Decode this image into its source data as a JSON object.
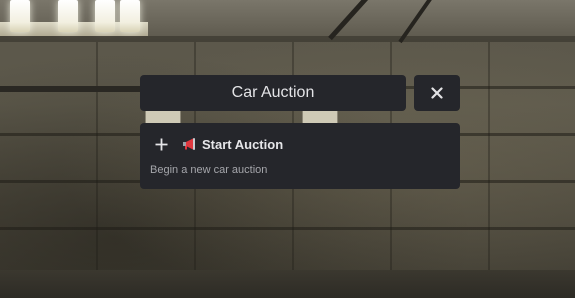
{
  "menu": {
    "title": "Car Auction",
    "close_icon": "close-icon",
    "items": [
      {
        "icon": "plus-icon",
        "emoji_icon": "megaphone-icon",
        "title": "Start Auction",
        "description": "Begin a new car auction"
      }
    ]
  },
  "colors": {
    "panel_bg": "#25262b",
    "text_primary": "#e3e3e6",
    "text_secondary": "#a5a6ab",
    "megaphone_red": "#e0383f"
  }
}
